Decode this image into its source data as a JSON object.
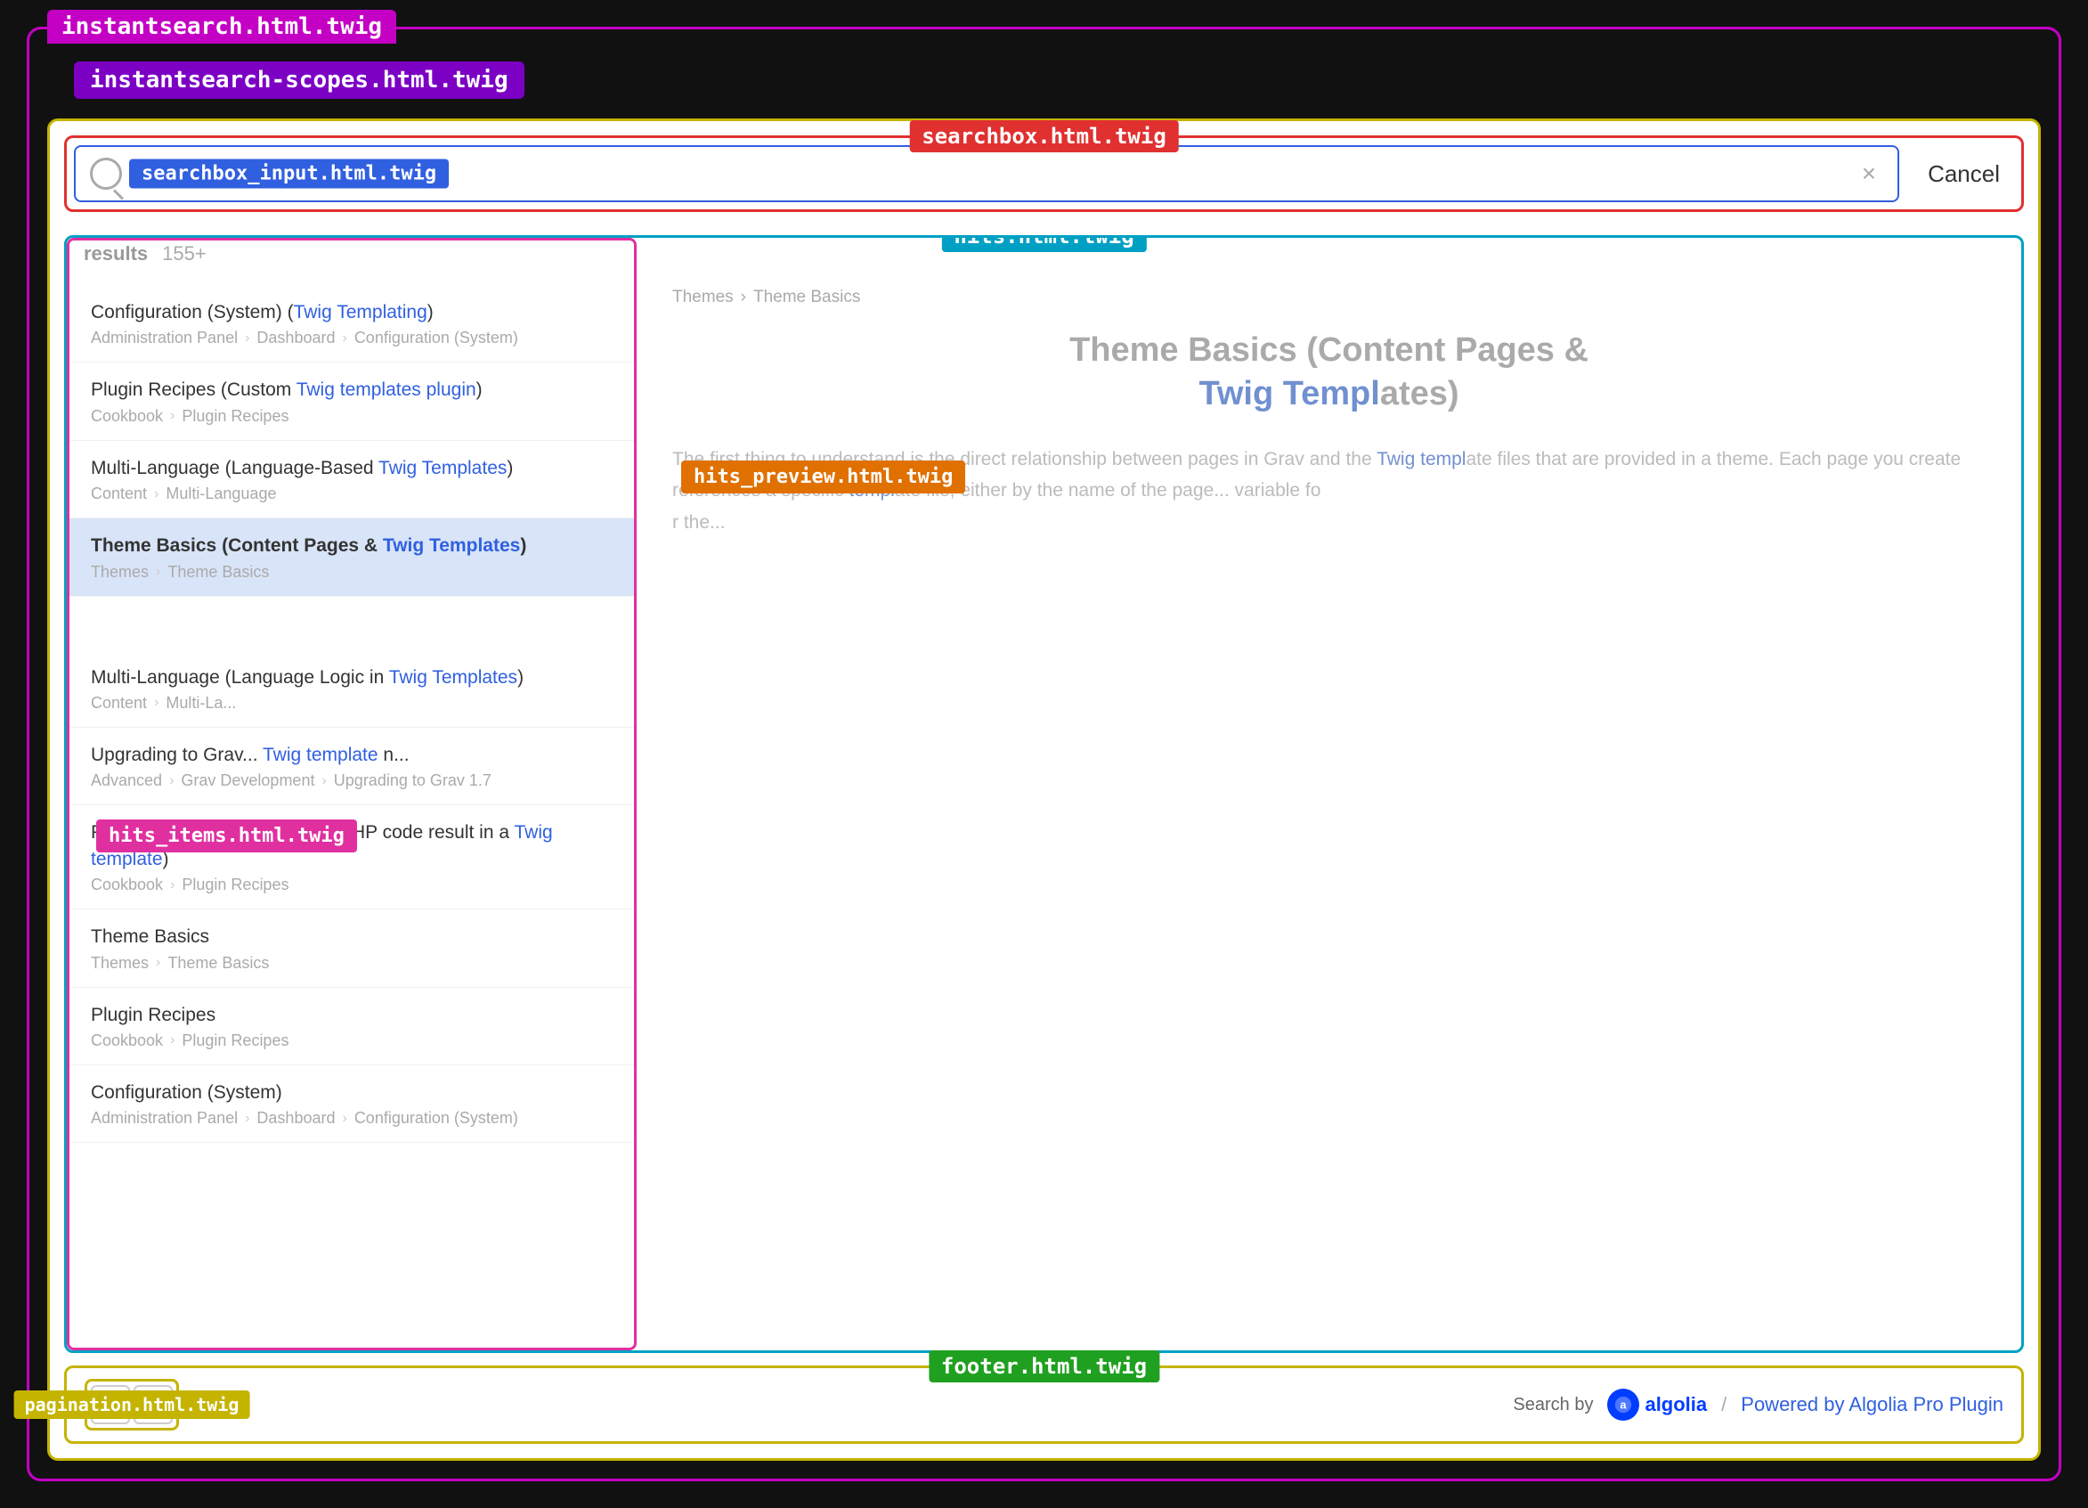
{
  "tabs": {
    "instantsearch": "instantsearch.html.twig",
    "scopes": "instantsearch-scopes.html.twig"
  },
  "labels": {
    "searchbox": "searchbox.html.twig",
    "searchbox_input": "searchbox_input.html.twig",
    "hits": "hits.html.twig",
    "hits_items": "hits_items.html.twig",
    "hits_preview": "hits_preview.html.twig",
    "pagination": "pagination.html.twig",
    "footer": "footer.html.twig"
  },
  "searchbox": {
    "cancel": "Cancel",
    "clear": "×"
  },
  "results": {
    "label": "results",
    "count": "155+"
  },
  "hits": [
    {
      "title": "Configuration (System) (Twig Templating)",
      "title_plain": "Configuration (System) (",
      "title_highlight": "Twig Templating",
      "title_end": ")",
      "breadcrumb": [
        "Administration Panel",
        "Dashboard",
        "Configuration (System)"
      ],
      "active": false
    },
    {
      "title": "Plugin Recipes (Custom Twig templates plugin)",
      "title_plain": "Plugin Recipes (Custom ",
      "title_highlight": "Twig templates plugin",
      "title_end": ")",
      "breadcrumb": [
        "Cookbook",
        "Plugin Recipes"
      ],
      "active": false
    },
    {
      "title": "Multi-Language (Language-Based Twig Templates)",
      "title_plain": "Multi-Language (Language-Based ",
      "title_highlight": "Twig Templates",
      "title_end": ")",
      "breadcrumb": [
        "Content",
        "Multi-Language"
      ],
      "active": false
    },
    {
      "title": "Theme Basics (Content Pages & Twig Templates)",
      "title_plain": "Theme Basics (Content Pages & ",
      "title_highlight": "Twig Templates",
      "title_end": ")",
      "breadcrumb": [
        "Themes",
        "Theme Basics"
      ],
      "active": true
    },
    {
      "title": "Multi-Language (Language Logic in Twig Templates)",
      "title_plain": "Multi-Language (Language Logic in ",
      "title_highlight": "Twig Templates",
      "title_end": ")",
      "breadcrumb": [
        "Content",
        "Multi-La..."
      ],
      "active": false
    },
    {
      "title_plain": "Upgrading to Grav... ",
      "title_highlight": "Twig template",
      "title_end": " n...",
      "title": "Upgrading to Grav... Twig template n...",
      "breadcrumb": [
        "Advanced",
        "Grav Development",
        "Upgrading to Grav 1.7"
      ],
      "active": false
    },
    {
      "title": "Plugin Recipes (Output some PHP code result in a Twig template)",
      "title_plain": "Plugin Recipes (Output some PHP code result in a ",
      "title_highlight": "Twig template",
      "title_end": ")",
      "breadcrumb": [
        "Cookbook",
        "Plugin Recipes"
      ],
      "active": false
    },
    {
      "title": "Theme Basics",
      "title_plain": "Theme Basics",
      "title_highlight": "",
      "title_end": "",
      "breadcrumb": [
        "Themes",
        "Theme Basics"
      ],
      "active": false
    },
    {
      "title": "Plugin Recipes",
      "title_plain": "Plugin Recipes",
      "title_highlight": "",
      "title_end": "",
      "breadcrumb": [
        "Cookbook",
        "Plugin Recipes"
      ],
      "active": false
    },
    {
      "title": "Configuration (System)",
      "title_plain": "Configuration (System)",
      "title_highlight": "",
      "title_end": "",
      "breadcrumb": [
        "Administration Panel",
        "Dashboard",
        "Configuration (System)"
      ],
      "active": false
    }
  ],
  "preview": {
    "breadcrumb": [
      "Themes",
      "Theme Basics"
    ],
    "title_plain": "Theme Basics (Content Pages &",
    "title_highlight": "Twig Templ",
    "title_end": "ates)",
    "body_parts": [
      "The first thing to understand is the direct relationship between pages in Grav and the ",
      "Twig templ",
      "ate files that are provided in a theme. Each page you create references a specific ",
      "templ",
      "ate file, either by the name of the pag",
      "e...",
      " variable fo",
      "r the..."
    ]
  },
  "pagination": {
    "prev": "<",
    "next": ">",
    "label": "pagination.html.twig"
  },
  "footer": {
    "label": "footer.html.twig",
    "search_by": "Search by",
    "algolia": "algolia",
    "divider": "/",
    "powered": "Powered by Algolia Pro Plugin"
  }
}
